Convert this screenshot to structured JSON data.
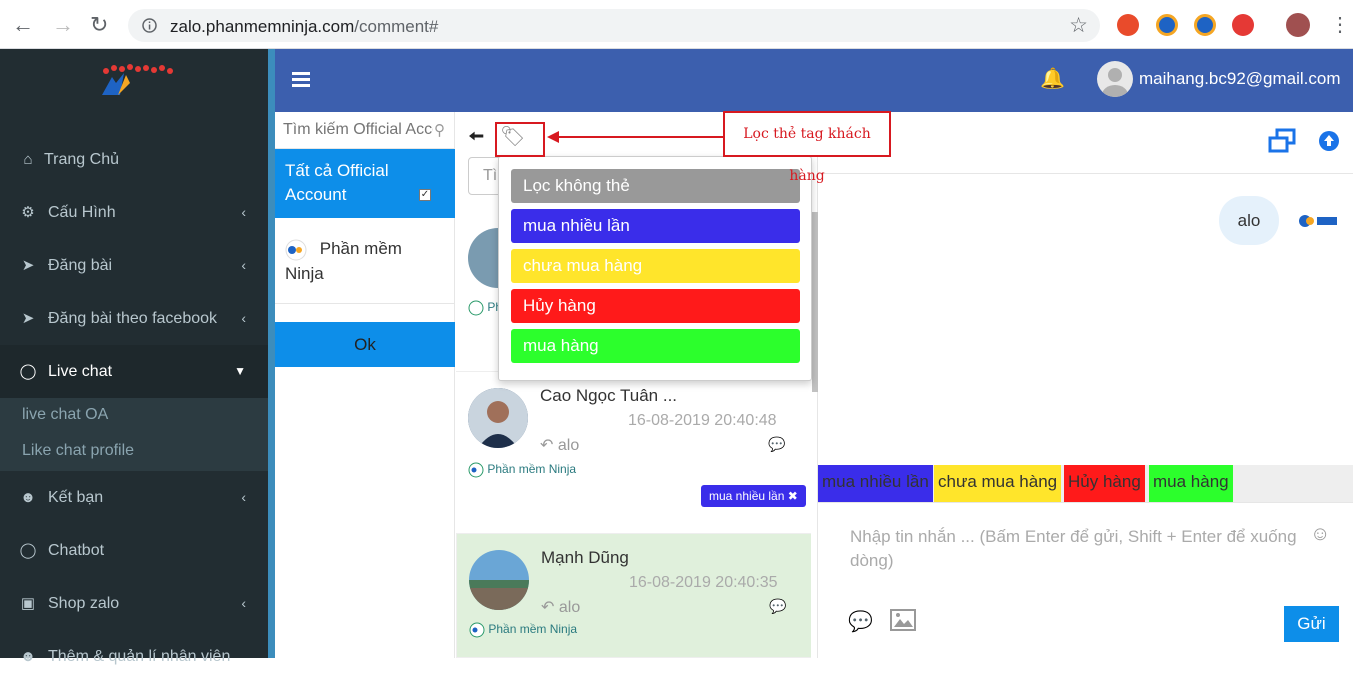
{
  "browser": {
    "url_host": "zalo.phanmemninja.com",
    "url_path": "/comment#"
  },
  "sidebar": {
    "items": [
      {
        "label": "Trang Chủ",
        "icon": "home-icon"
      },
      {
        "label": "Cấu Hình",
        "icon": "gear-icon"
      },
      {
        "label": "Đăng bài",
        "icon": "paper-plane-icon"
      },
      {
        "label": "Đăng bài theo facebook",
        "icon": "paper-plane-icon"
      },
      {
        "label": "Live chat",
        "icon": "speech-bubble-icon"
      },
      {
        "label": "Kết bạn",
        "icon": "users-icon"
      },
      {
        "label": "Chatbot",
        "icon": "speech-bubble-icon"
      },
      {
        "label": "Shop zalo",
        "icon": "shopping-bag-icon"
      },
      {
        "label": "Thêm & quản lí nhân viên",
        "icon": "user-plus-icon"
      }
    ],
    "submenu": [
      "live chat OA",
      "Like chat profile"
    ]
  },
  "header": {
    "email": "maihang.bc92@gmail.com"
  },
  "accounts": {
    "search_placeholder": "Tìm kiếm Official Account",
    "all_label": "Tất cả Official Account",
    "ninja_label": "Phần mềm Ninja",
    "ok_label": "Ok"
  },
  "conversations": {
    "search_placeholder": "Tìm",
    "items": [
      {
        "name": "Cao Ngọc Tuân ...",
        "time": "16-08-2019 20:40:48",
        "last": "alo",
        "source": "Phần mềm Ninja",
        "tag": "mua nhiều lần"
      },
      {
        "name": "Mạnh Dũng",
        "time": "16-08-2019 20:40:35",
        "last": "alo",
        "source": "Phần mềm Ninja"
      }
    ],
    "partial_source": "Ph"
  },
  "tag_filter": {
    "options": [
      {
        "label": "Lọc không thẻ",
        "color": "#999999"
      },
      {
        "label": "mua nhiều lần",
        "color": "#3a2dea"
      },
      {
        "label": "chưa mua hàng",
        "color": "#ffe52b"
      },
      {
        "label": "Hủy hàng",
        "color": "#ff1a1a"
      },
      {
        "label": "mua hàng",
        "color": "#2cff2c"
      }
    ]
  },
  "annotation": "Lọc thẻ tag khách hàng",
  "chat": {
    "message": "alo",
    "tags": [
      {
        "label": "mua nhiều lần",
        "color": "#3a2dea"
      },
      {
        "label": "chưa mua hàng",
        "color": "#ffe52b"
      },
      {
        "label": "Hủy hàng",
        "color": "#ff1a1a"
      },
      {
        "label": "mua hàng",
        "color": "#2cff2c"
      }
    ],
    "input_placeholder": "Nhập tin nhắn ... (Bấm Enter để gửi, Shift + Enter để xuống dòng)",
    "send_label": "Gửi"
  }
}
